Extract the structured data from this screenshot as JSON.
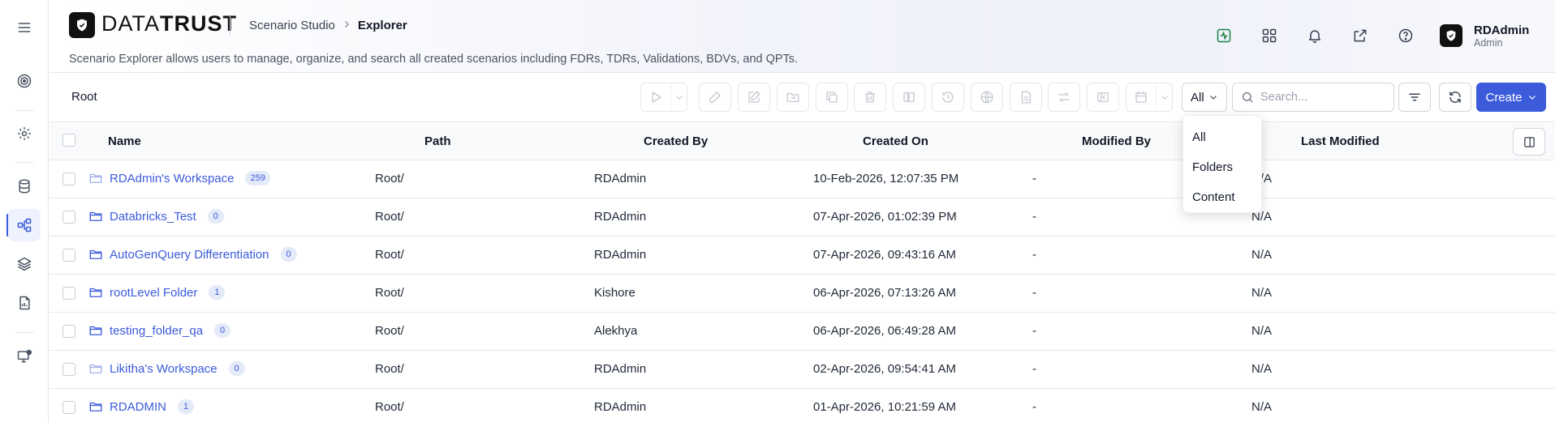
{
  "app": {
    "logo_light": "DATA",
    "logo_bold": "TRUST",
    "description": "Scenario Explorer allows users to manage, organize, and search all created scenarios including FDRs, TDRs, Validations, BDVs, and QPTs."
  },
  "breadcrumb": {
    "parent": "Scenario Studio",
    "current": "Explorer"
  },
  "sidebar": {
    "items": [
      {
        "icon": "menu-icon"
      },
      {
        "icon": "target-icon"
      },
      {
        "icon": "gear-icon"
      },
      {
        "icon": "database-icon"
      },
      {
        "icon": "hierarchy-icon",
        "active": true
      },
      {
        "icon": "layers-icon"
      },
      {
        "icon": "report-icon"
      },
      {
        "icon": "monitor-icon"
      }
    ]
  },
  "header_icons": [
    "activity-icon",
    "grid-icon",
    "bell-icon",
    "external-link-icon",
    "help-icon"
  ],
  "user": {
    "name": "RDAdmin",
    "role": "Admin"
  },
  "toolbar": {
    "root_label": "Root",
    "filter_value": "All",
    "search_placeholder": "Search...",
    "create_label": "Create"
  },
  "filter_menu": {
    "options": [
      "All",
      "Folders",
      "Content"
    ]
  },
  "table": {
    "columns": [
      "Name",
      "Path",
      "Created By",
      "Created On",
      "Modified By",
      "Last Modified"
    ],
    "rows": [
      {
        "name": "RDAdmin's Workspace",
        "count": "259",
        "path": "Root/",
        "created_by": "RDAdmin",
        "created_on": "10-Feb-2026, 12:07:35 PM",
        "modified_by": "-",
        "last_modified": "N/A",
        "workspace": true
      },
      {
        "name": "Databricks_Test",
        "count": "0",
        "path": "Root/",
        "created_by": "RDAdmin",
        "created_on": "07-Apr-2026, 01:02:39 PM",
        "modified_by": "-",
        "last_modified": "N/A",
        "workspace": false
      },
      {
        "name": "AutoGenQuery Differentiation",
        "count": "0",
        "path": "Root/",
        "created_by": "RDAdmin",
        "created_on": "07-Apr-2026, 09:43:16 AM",
        "modified_by": "-",
        "last_modified": "N/A",
        "workspace": false
      },
      {
        "name": "rootLevel Folder",
        "count": "1",
        "path": "Root/",
        "created_by": "Kishore",
        "created_on": "06-Apr-2026, 07:13:26 AM",
        "modified_by": "-",
        "last_modified": "N/A",
        "workspace": false
      },
      {
        "name": "testing_folder_qa",
        "count": "0",
        "path": "Root/",
        "created_by": "Alekhya",
        "created_on": "06-Apr-2026, 06:49:28 AM",
        "modified_by": "-",
        "last_modified": "N/A",
        "workspace": false
      },
      {
        "name": "Likitha's Workspace",
        "count": "0",
        "path": "Root/",
        "created_by": "RDAdmin",
        "created_on": "02-Apr-2026, 09:54:41 AM",
        "modified_by": "-",
        "last_modified": "N/A",
        "workspace": true
      },
      {
        "name": "RDADMIN",
        "count": "1",
        "path": "Root/",
        "created_by": "RDAdmin",
        "created_on": "01-Apr-2026, 10:21:59 AM",
        "modified_by": "-",
        "last_modified": "N/A",
        "workspace": false
      }
    ]
  },
  "colors": {
    "accent": "#3b5bdb",
    "badge_bg": "#e5eaf8",
    "disabled_icon": "#c4c8d0"
  }
}
